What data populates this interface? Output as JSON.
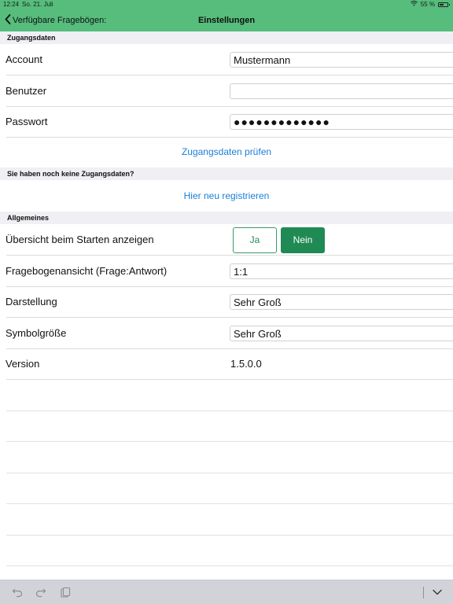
{
  "statusbar": {
    "time": "12:24",
    "date": "So. 21. Juli",
    "battery": "55 %",
    "icons": [
      "wifi-icon",
      "battery-icon"
    ]
  },
  "navbar": {
    "back_label": "Verfügbare Fragebögen:",
    "title": "Einstellungen",
    "back_icon": "chevron-left-icon"
  },
  "zugangsdaten": {
    "header": "Zugangsdaten",
    "account": {
      "label": "Account",
      "value": "Mustermann"
    },
    "benutzer": {
      "label": "Benutzer",
      "value": ""
    },
    "passwort": {
      "label": "Passwort",
      "value": "●●●●●●●●●●●●●"
    },
    "check_link": "Zugangsdaten prüfen"
  },
  "registration": {
    "header": "Sie haben noch keine Zugangsdaten?",
    "register_link": "Hier neu registrieren"
  },
  "allgemeines": {
    "header": "Allgemeines",
    "overview": {
      "label": "Übersicht beim Starten anzeigen",
      "options": [
        "Ja",
        "Nein"
      ],
      "selected": "Nein"
    },
    "view_ratio": {
      "label": "Fragebogenansicht (Frage:Antwort)",
      "value": "1:1"
    },
    "display": {
      "label": "Darstellung",
      "value": "Sehr Groß"
    },
    "symbol_size": {
      "label": "Symbolgröße",
      "value": "Sehr Groß"
    },
    "version": {
      "label": "Version",
      "value": "1.5.0.0"
    }
  },
  "toolbar": {
    "icons": [
      "undo-icon",
      "redo-icon",
      "paste-icon",
      "keyboard-dismiss-icon"
    ]
  },
  "colors": {
    "accent_green": "#56bd7c",
    "selected_green": "#1f8a54",
    "link_blue": "#1a7fd6",
    "group_bg": "#efeff4"
  }
}
